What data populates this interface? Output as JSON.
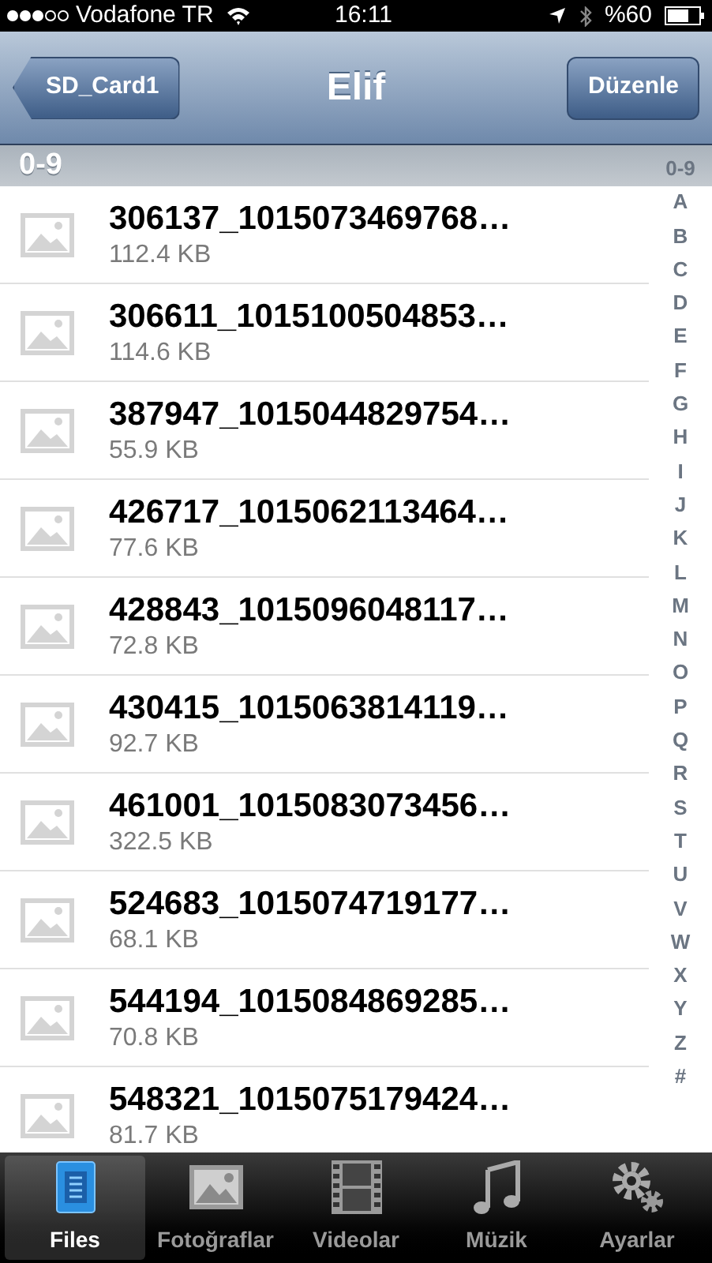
{
  "status_bar": {
    "carrier": "Vodafone TR",
    "time": "16:11",
    "battery": "%60"
  },
  "nav_bar": {
    "back_button": "SD_Card1",
    "title": "Elif",
    "edit_button": "Düzenle"
  },
  "section_header": "0-9",
  "files": [
    {
      "name": "306137_1015073469768…",
      "size": "112.4 KB"
    },
    {
      "name": "306611_1015100504853…",
      "size": "114.6 KB"
    },
    {
      "name": "387947_1015044829754…",
      "size": "55.9 KB"
    },
    {
      "name": "426717_1015062113464…",
      "size": "77.6 KB"
    },
    {
      "name": "428843_1015096048117…",
      "size": "72.8 KB"
    },
    {
      "name": "430415_1015063814119…",
      "size": "92.7 KB"
    },
    {
      "name": "461001_1015083073456…",
      "size": "322.5 KB"
    },
    {
      "name": "524683_1015074719177…",
      "size": "68.1 KB"
    },
    {
      "name": "544194_1015084869285…",
      "size": "70.8 KB"
    },
    {
      "name": "548321_1015075179424…",
      "size": "81.7 KB"
    }
  ],
  "index": [
    "0-9",
    "A",
    "B",
    "C",
    "D",
    "E",
    "F",
    "G",
    "H",
    "I",
    "J",
    "K",
    "L",
    "M",
    "N",
    "O",
    "P",
    "Q",
    "R",
    "S",
    "T",
    "U",
    "V",
    "W",
    "X",
    "Y",
    "Z",
    "#"
  ],
  "tab_bar": [
    {
      "label": "Files",
      "kind": "files",
      "selected": true
    },
    {
      "label": "Fotoğraflar",
      "kind": "photos",
      "selected": false
    },
    {
      "label": "Videolar",
      "kind": "videos",
      "selected": false
    },
    {
      "label": "Müzik",
      "kind": "music",
      "selected": false
    },
    {
      "label": "Ayarlar",
      "kind": "settings",
      "selected": false
    }
  ]
}
